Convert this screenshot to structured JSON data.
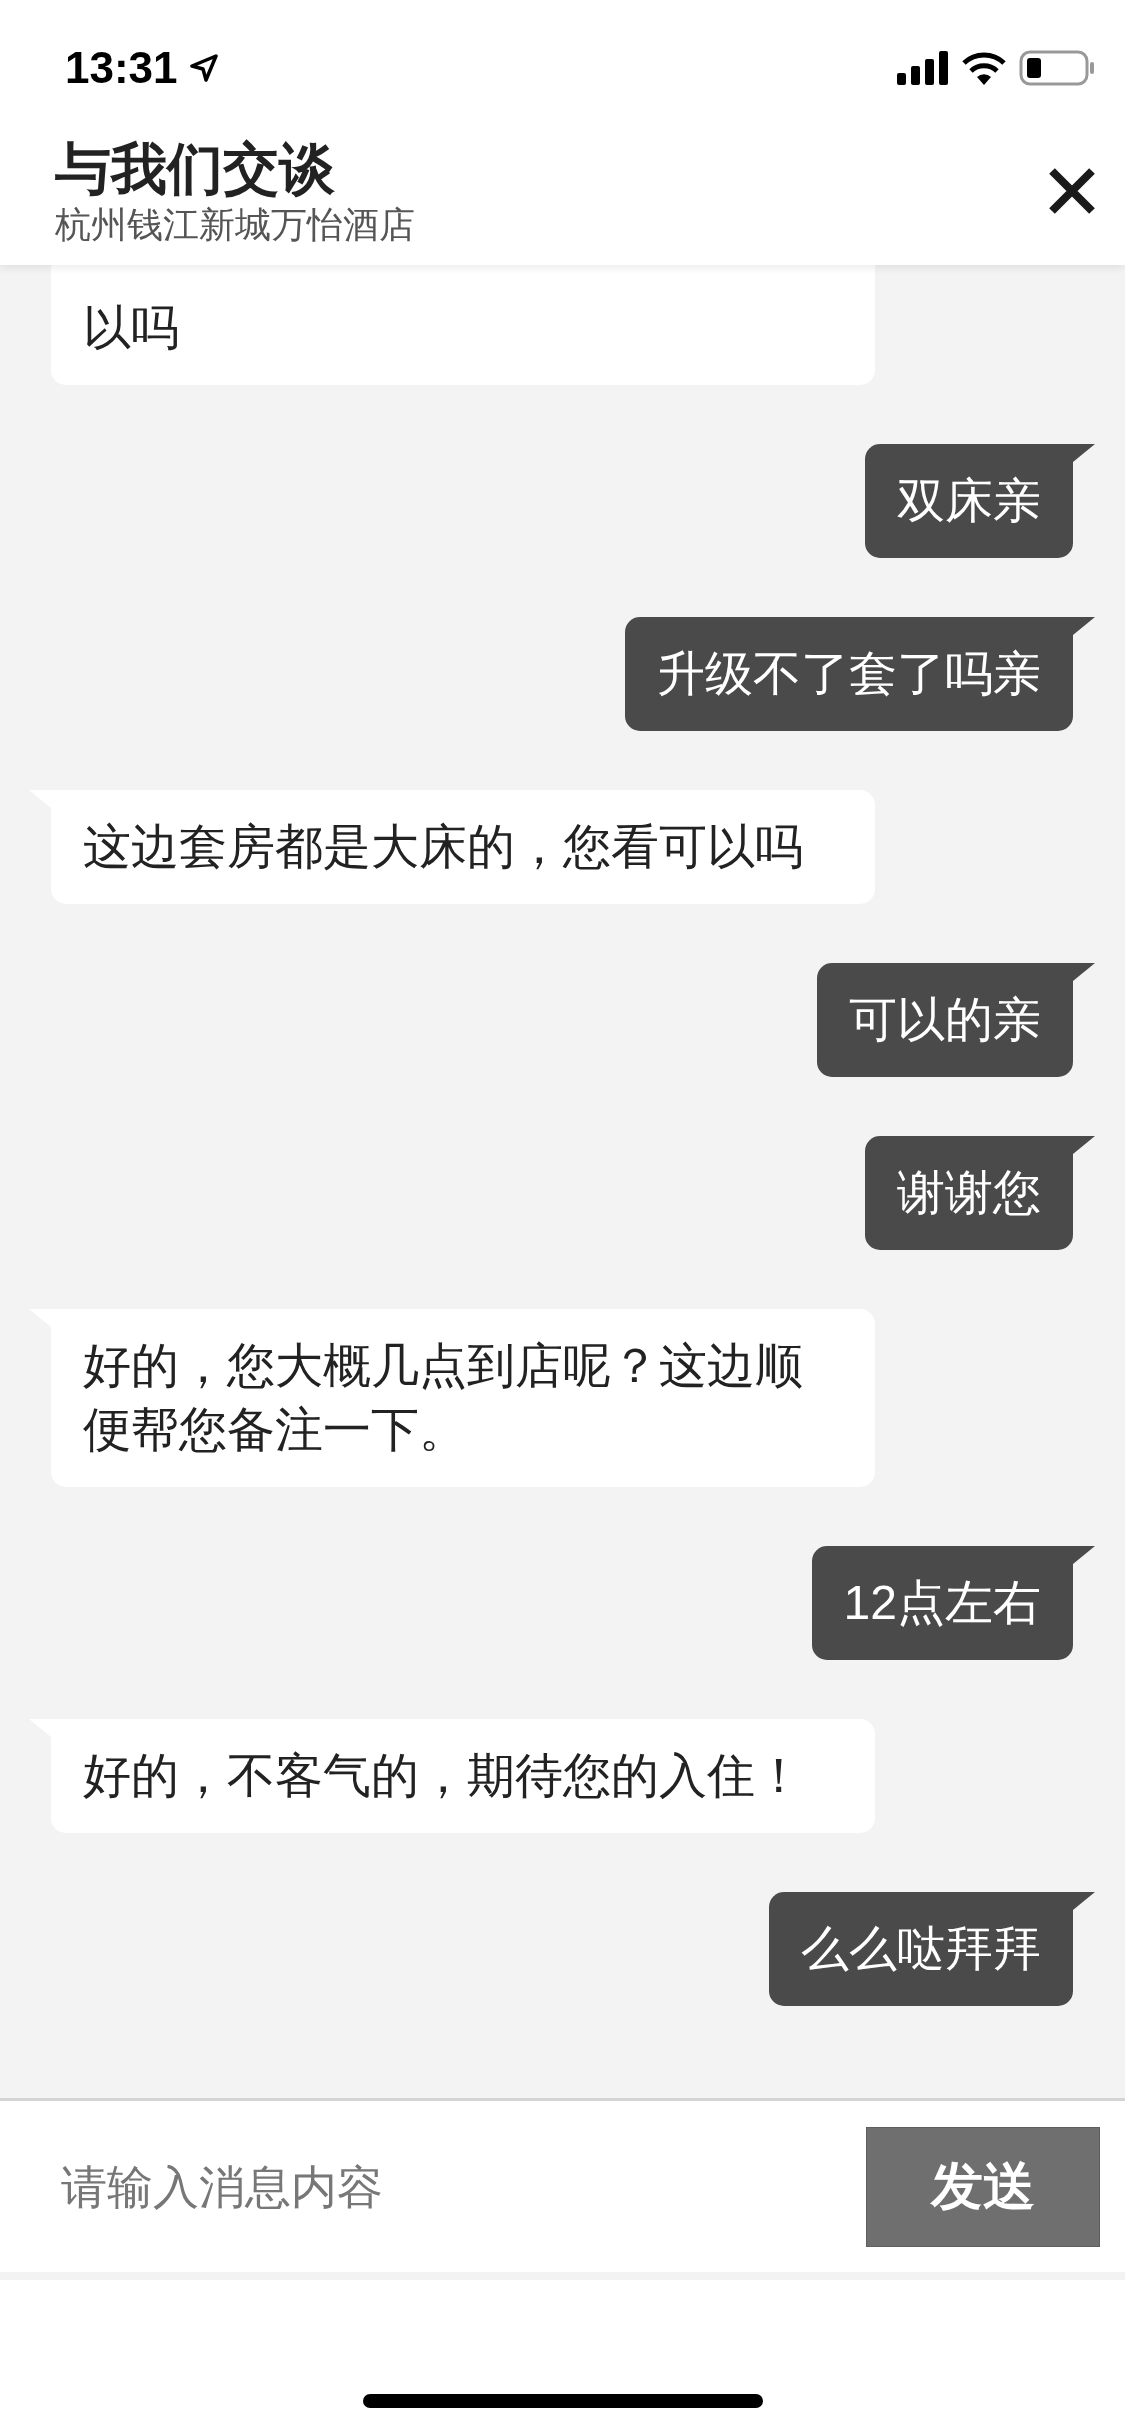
{
  "status_bar": {
    "time": "13:31"
  },
  "header": {
    "title": "与我们交谈",
    "subtitle": "杭州钱江新城万怡酒店"
  },
  "messages": [
    {
      "kind": "agent",
      "text": "以吗",
      "partly_hidden": true
    },
    {
      "kind": "user",
      "text": "双床亲"
    },
    {
      "kind": "user",
      "text": "升级不了套了吗亲"
    },
    {
      "kind": "agent",
      "text": "这边套房都是大床的，您看可以吗"
    },
    {
      "kind": "user",
      "text": "可以的亲"
    },
    {
      "kind": "user",
      "text": "谢谢您"
    },
    {
      "kind": "agent",
      "text": "好的，您大概几点到店呢？这边顺便帮您备注一下。"
    },
    {
      "kind": "user",
      "text": "12点左右"
    },
    {
      "kind": "agent",
      "text": "好的，不客气的，期待您的入住！"
    },
    {
      "kind": "user",
      "text": "么么哒拜拜"
    }
  ],
  "composer": {
    "placeholder": "请输入消息内容",
    "send_label": "发送"
  }
}
